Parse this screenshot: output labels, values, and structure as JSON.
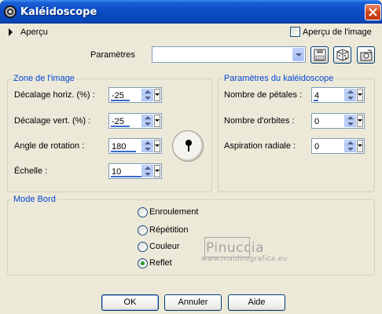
{
  "window": {
    "title": "Kaléidoscope",
    "icon": "kaleidoscope-app-icon"
  },
  "preview": {
    "section_label": "Aperçu",
    "checkbox_label": "Aperçu de l'image",
    "checkbox_checked": false
  },
  "presets": {
    "label": "Paramètres",
    "value": ""
  },
  "toolbar": {
    "icons": [
      "save-preset-icon",
      "random-dice-icon",
      "preset-manager-icon"
    ]
  },
  "zone_group": {
    "title": "Zone de l'image",
    "fields": [
      {
        "label": "Décalage horiz. (%) :",
        "value": "-25",
        "fill": 0.375
      },
      {
        "label": "Décalage vert. (%) :",
        "value": "-25",
        "fill": 0.375
      },
      {
        "label": "Angle de rotation :",
        "value": "180",
        "fill": 0.5
      },
      {
        "label": "Échelle :",
        "value": "10",
        "fill": 0.74
      }
    ]
  },
  "kaleido_group": {
    "title": "Paramètres du kaléidoscope",
    "fields": [
      {
        "label": "Nombre de pétales :",
        "value": "4",
        "fill": 0.1
      },
      {
        "label": "Nombre d'orbites :",
        "value": "0",
        "fill": 0
      },
      {
        "label": "Aspiration radiale :",
        "value": "0",
        "fill": 0
      }
    ]
  },
  "edge_group": {
    "title": "Mode Bord",
    "options": [
      "Enroulement",
      "Répétition",
      "Couleur",
      "Reflet"
    ],
    "selected": "Reflet"
  },
  "watermark": {
    "name": "Pinuccia",
    "site": "www.maidiregrafica.eu"
  },
  "buttons": {
    "ok": "OK",
    "cancel": "Annuler",
    "help": "Aide"
  },
  "colors": {
    "titlebar": "#0a4ac4",
    "group_title": "#0046d5",
    "background": "#ece9d8",
    "slider_bar": "#3a6bd1"
  }
}
